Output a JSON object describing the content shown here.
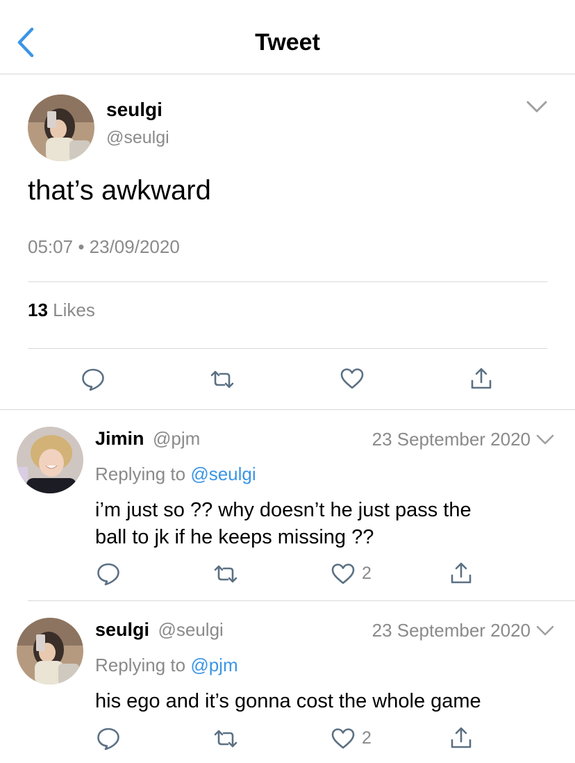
{
  "header": {
    "title": "Tweet",
    "back_icon": "chevron-left-icon"
  },
  "main_tweet": {
    "name": "seulgi",
    "handle": "@seulgi",
    "text": "that’s awkward",
    "time": "05:07",
    "separator": "•",
    "date": "23/09/2020",
    "likes_count": "13",
    "likes_label": "Likes"
  },
  "replies": [
    {
      "name": "Jimin",
      "handle": "@pjm",
      "date": "23 September 2020",
      "replying_label": "Replying to",
      "replying_to": "@seulgi",
      "text_line1": "i’m just so ?? why doesn’t he just pass the",
      "text_line2": "ball to jk if he keeps missing ??",
      "like_count": "2"
    },
    {
      "name": "seulgi",
      "handle": "@seulgi",
      "date": "23 September 2020",
      "replying_label": "Replying to",
      "replying_to": "@pjm",
      "text_line1": "his ego and it’s gonna cost the whole game",
      "like_count": "2"
    }
  ],
  "colors": {
    "link_blue": "#3a95e6",
    "gray_text": "#8a8a8a",
    "divider": "#d8d8d8",
    "icon_gray": "#5b7083"
  }
}
